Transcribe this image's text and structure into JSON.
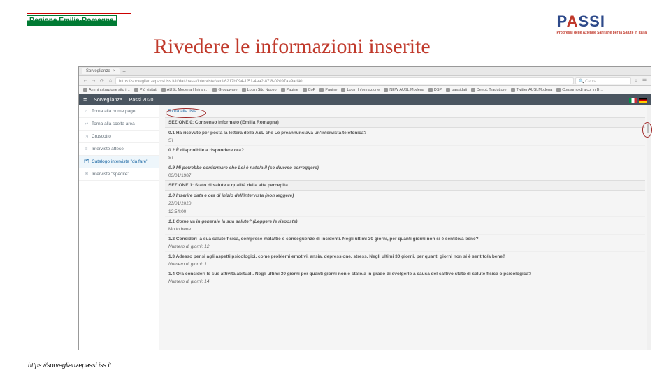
{
  "slide": {
    "title": "Rivedere le informazioni inserite",
    "region_logo": "Regione Emilia-Romagna",
    "passi_logo": "PASSI",
    "passi_sub": "Progressi delle Aziende Sanitarie per la Salute in Italia",
    "footer_url": "https://sorveglianzepassi.iss.it"
  },
  "browser": {
    "tab_title": "Sorveglianze",
    "url": "https://sorveglianzepassi.iss.it/it/dati/passi/interviste/vedi/6217b094-1f51-4aa2-87f8-02097aa9ad40",
    "search_placeholder": "Cerca",
    "bookmarks": [
      "Amministrazione sito j…",
      "Più visitati",
      "AUSL Modena | Intran…",
      "Groupware",
      "Login Sito Nuovo",
      "Pagine",
      "CoP",
      "Pagine",
      "Login Informazione",
      "NEW AUSL Modena",
      "DSP",
      "passidati",
      "DeepL Traduttore",
      "Twitter AUSLModena",
      "Consumo di alcol in B…"
    ]
  },
  "app": {
    "menu1": "Sorveglianze",
    "menu2": "Passi 2020",
    "sidebar": [
      {
        "icon": "⌂",
        "label": "Torna alla home page"
      },
      {
        "icon": "↩",
        "label": "Torna alla scelta area"
      },
      {
        "icon": "◷",
        "label": "Cruscotto"
      },
      {
        "icon": "≡",
        "label": "Interviste attese"
      },
      {
        "icon": "🗂",
        "label": "Catalogo interviste \"da fare\""
      },
      {
        "icon": "✉",
        "label": "Interviste \"spedite\""
      }
    ],
    "back_link": "Torna alla lista"
  },
  "interview": {
    "sec0": "SEZIONE 0: Consenso informato (Emilia Romagna)",
    "q01": "0.1 Ha ricevuto per posta la lettera della ASL che Le preannunciava un'intervista telefonica?",
    "a01": "Sì",
    "q02": "0.2 È disponibile a rispondere ora?",
    "a02": "Sì",
    "q09": "0.9 Mi potrebbe confermare che Lei è nato/a il (se diverso correggere)",
    "a09": "03/01/1987",
    "sec1": "SEZIONE 1: Stato di salute e qualità della vita percepita",
    "q10": "1.0 Inserire data e ora di inizio dell'intervista (non leggere)",
    "a10a": "23/01/2020",
    "a10b": "12:54:00",
    "q11": "1.1 Come va in generale la sua salute? (Leggere le risposte)",
    "a11": "Molto bene",
    "q12": "1.2 Consideri la sua salute fisica, comprese malattie e conseguenze di incidenti. Negli ultimi 30 giorni, per quanti giorni non si è sentito/a bene?",
    "a12": "Numero di giorni: 12",
    "q13": "1.3 Adesso pensi agli aspetti psicologici, come problemi emotivi, ansia, depressione, stress. Negli ultimi 30 giorni, per quanti giorni non si è sentito/a bene?",
    "a13": "Numero di giorni: 1",
    "q14": "1.4 Ora consideri le sue attività abituali. Negli ultimi 30 giorni per quanti giorni non è stato/a in grado di svolgerle a causa del cattivo stato di salute fisica o psicologica?",
    "a14": "Numero di giorni: 14"
  }
}
